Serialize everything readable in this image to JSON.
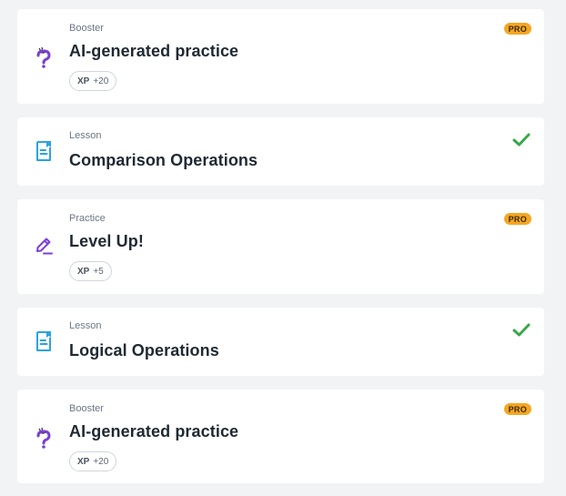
{
  "colors": {
    "page_bg": "#f1f3f5",
    "card_bg": "#ffffff",
    "pro_badge": "#f5a623",
    "check_green": "#3aa84a",
    "lesson_blue": "#2aa3e0",
    "booster_purple": "#7b3fd1"
  },
  "cards": [
    {
      "kind": "Booster",
      "title": "AI-generated practice",
      "xp_label": "XP",
      "xp_value": "+20",
      "badge": "PRO",
      "icon": "ai-question-icon",
      "status": "locked"
    },
    {
      "kind": "Lesson",
      "title": "Comparison Operations",
      "icon": "lesson-document-icon",
      "status": "completed"
    },
    {
      "kind": "Practice",
      "title": "Level Up!",
      "xp_label": "XP",
      "xp_value": "+5",
      "badge": "PRO",
      "icon": "practice-pencil-icon",
      "status": "locked"
    },
    {
      "kind": "Lesson",
      "title": "Logical Operations",
      "icon": "lesson-document-icon",
      "status": "completed"
    },
    {
      "kind": "Booster",
      "title": "AI-generated practice",
      "xp_label": "XP",
      "xp_value": "+20",
      "badge": "PRO",
      "icon": "ai-question-icon",
      "status": "locked"
    }
  ]
}
